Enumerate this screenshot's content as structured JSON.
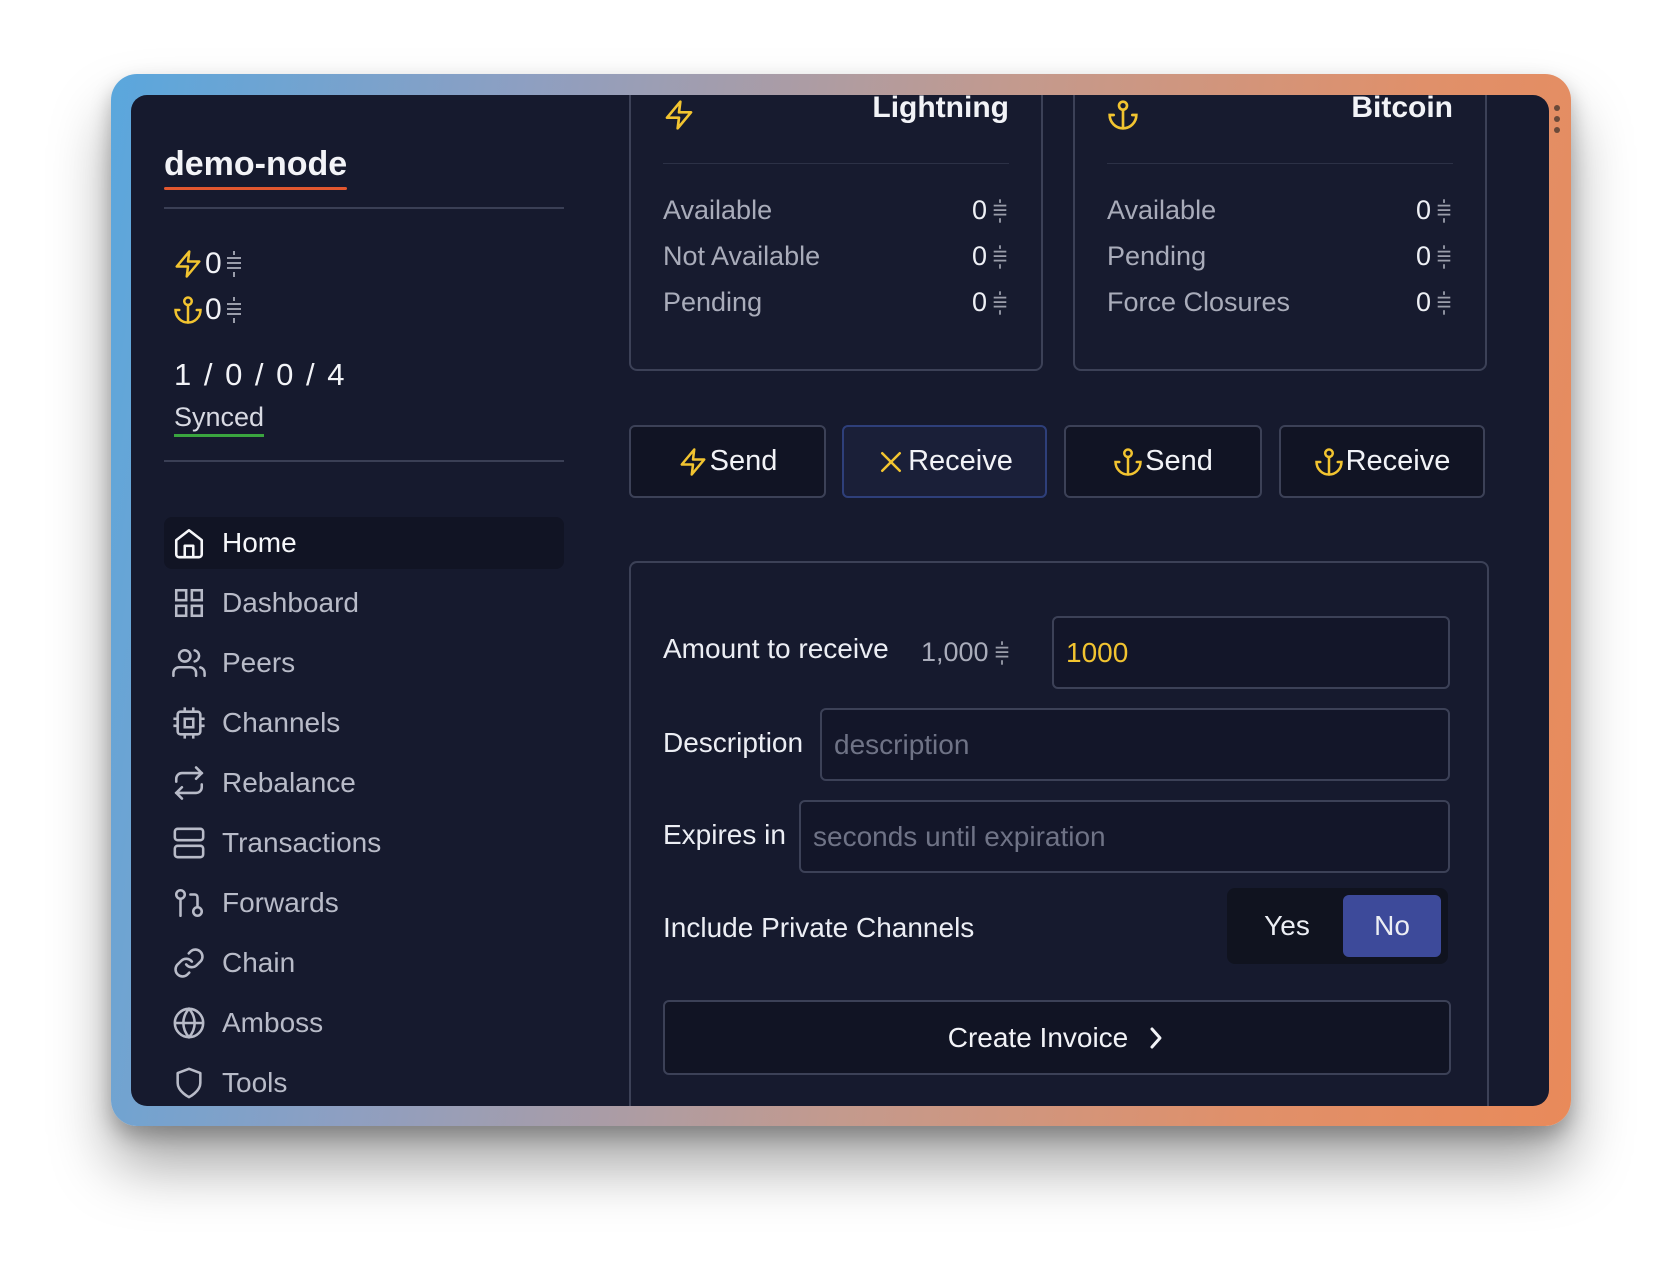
{
  "sidebar": {
    "node_name": "demo-node",
    "lightning_balance": "0",
    "onchain_balance": "0",
    "channel_counts": "1 / 0 / 0 / 4",
    "sync_status": "Synced",
    "nav": [
      {
        "label": "Home",
        "icon": "home-icon",
        "active": true
      },
      {
        "label": "Dashboard",
        "icon": "grid-icon"
      },
      {
        "label": "Peers",
        "icon": "users-icon"
      },
      {
        "label": "Channels",
        "icon": "cpu-icon"
      },
      {
        "label": "Rebalance",
        "icon": "repeat-icon"
      },
      {
        "label": "Transactions",
        "icon": "server-icon"
      },
      {
        "label": "Forwards",
        "icon": "git-pull-request-icon"
      },
      {
        "label": "Chain",
        "icon": "link-icon"
      },
      {
        "label": "Amboss",
        "icon": "globe-icon"
      },
      {
        "label": "Tools",
        "icon": "shield-icon"
      }
    ]
  },
  "lightning_card": {
    "title": "Lightning",
    "rows": [
      {
        "label": "Available",
        "value": "0"
      },
      {
        "label": "Not Available",
        "value": "0"
      },
      {
        "label": "Pending",
        "value": "0"
      }
    ]
  },
  "bitcoin_card": {
    "title": "Bitcoin",
    "rows": [
      {
        "label": "Available",
        "value": "0"
      },
      {
        "label": "Pending",
        "value": "0"
      },
      {
        "label": "Force Closures",
        "value": "0"
      }
    ]
  },
  "actions": {
    "ln_send": "Send",
    "ln_receive": "Receive",
    "chain_send": "Send",
    "chain_receive": "Receive"
  },
  "receive_form": {
    "amount_label": "Amount to receive",
    "amount_display": "1,000",
    "amount_value": "1000",
    "description_label": "Description",
    "description_placeholder": "description",
    "expires_label": "Expires in",
    "expires_placeholder": "seconds until expiration",
    "private_label": "Include Private Channels",
    "private_yes": "Yes",
    "private_no": "No",
    "private_selected": "No",
    "submit_label": "Create Invoice"
  },
  "colors": {
    "accent_yellow": "#f2c430",
    "selected_blue": "#3d4a9a",
    "synced_green": "#3aa53f",
    "title_underline": "#e2572f"
  }
}
